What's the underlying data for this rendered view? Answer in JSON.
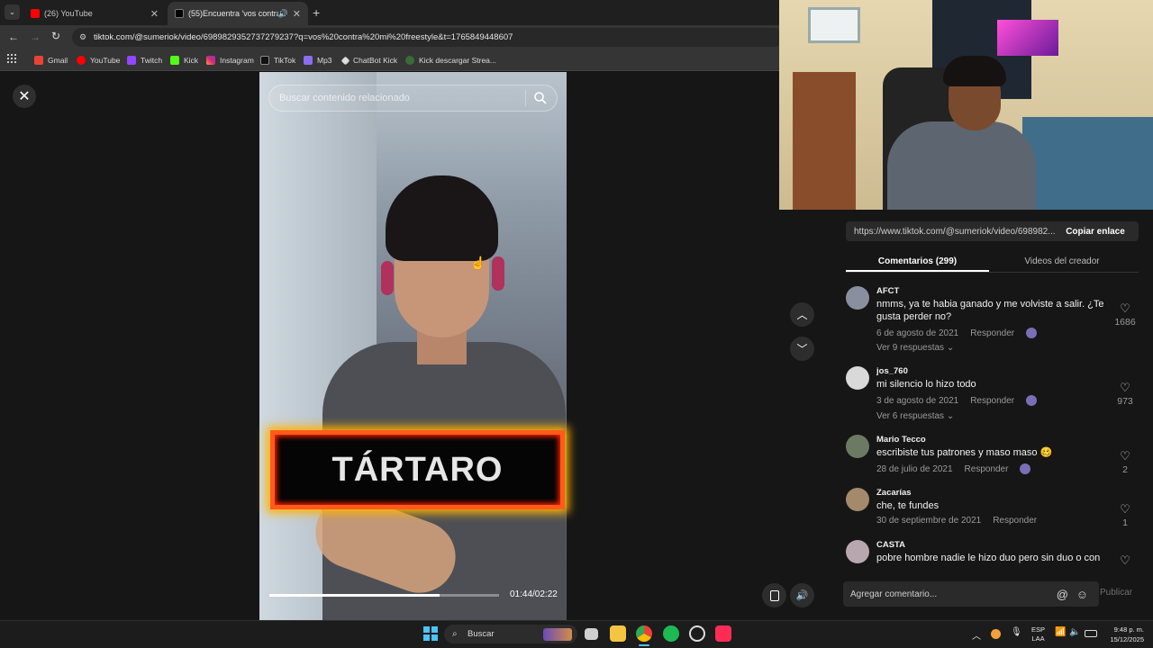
{
  "browser": {
    "tabs": [
      {
        "title": "(26) YouTube",
        "active": false
      },
      {
        "title": "(55)Encuentra 'vos contra m",
        "active": true
      }
    ],
    "url": "tiktok.com/@sumeriok/video/6989829352737279237?q=vos%20contra%20mi%20freestyle&t=1765849448607",
    "bookmarks": [
      "Gmail",
      "YouTube",
      "Twitch",
      "Kick",
      "Instagram",
      "TikTok",
      "Mp3",
      "ChatBot Kick",
      "Kick descargar Strea..."
    ]
  },
  "video": {
    "search_placeholder": "Buscar contenido relacionado",
    "overlay_title": "TÁRTARO",
    "progress": 0.74,
    "time": "01:44/02:22"
  },
  "panel": {
    "share_link": "https://www.tiktok.com/@sumeriok/video/698982...",
    "copy_label": "Copiar enlace",
    "tabs": [
      "Comentarios (299)",
      "Videos del creador"
    ],
    "comments": [
      {
        "user": "AFCT",
        "text": "nmms, ya te habia ganado y me volviste a salir. ¿Te gusta perder no?",
        "date": "6 de agosto de 2021",
        "reply": "Responder",
        "replies": "Ver 9 respuestas",
        "likes": "1686",
        "avatar_color": "#8a8fa0"
      },
      {
        "user": "jos_760",
        "text": "mi silencio lo hizo todo",
        "date": "3 de agosto de 2021",
        "reply": "Responder",
        "replies": "Ver 6 respuestas",
        "likes": "973",
        "avatar_color": "#d9d9d9"
      },
      {
        "user": "Mario Tecco",
        "text": "escribiste tus patrones y maso maso 🥴",
        "date": "28 de julio de 2021",
        "reply": "Responder",
        "replies": "",
        "likes": "2",
        "avatar_color": "#6d7a63"
      },
      {
        "user": "Zacarías",
        "text": "che, te fundes",
        "date": "30 de septiembre de 2021",
        "reply": "Responder",
        "replies": "",
        "likes": "1",
        "avatar_color": "#a48a6a"
      },
      {
        "user": "CASTA",
        "text": "pobre hombre nadie le hizo duo pero sin duo o con",
        "date": "",
        "reply": "",
        "replies": "",
        "likes": "",
        "avatar_color": "#b9a7b0"
      }
    ],
    "comment_placeholder": "Agregar comentario...",
    "publish_label": "Publicar"
  },
  "taskbar": {
    "search_label": "Buscar",
    "lang": "ESP",
    "lang_sub": "LAA",
    "time": "9:48 p. m.",
    "date": "15/12/2025"
  },
  "colors": {
    "accent_tiktok": "#fe2c55",
    "banner_fire": "#ff5a1a"
  }
}
